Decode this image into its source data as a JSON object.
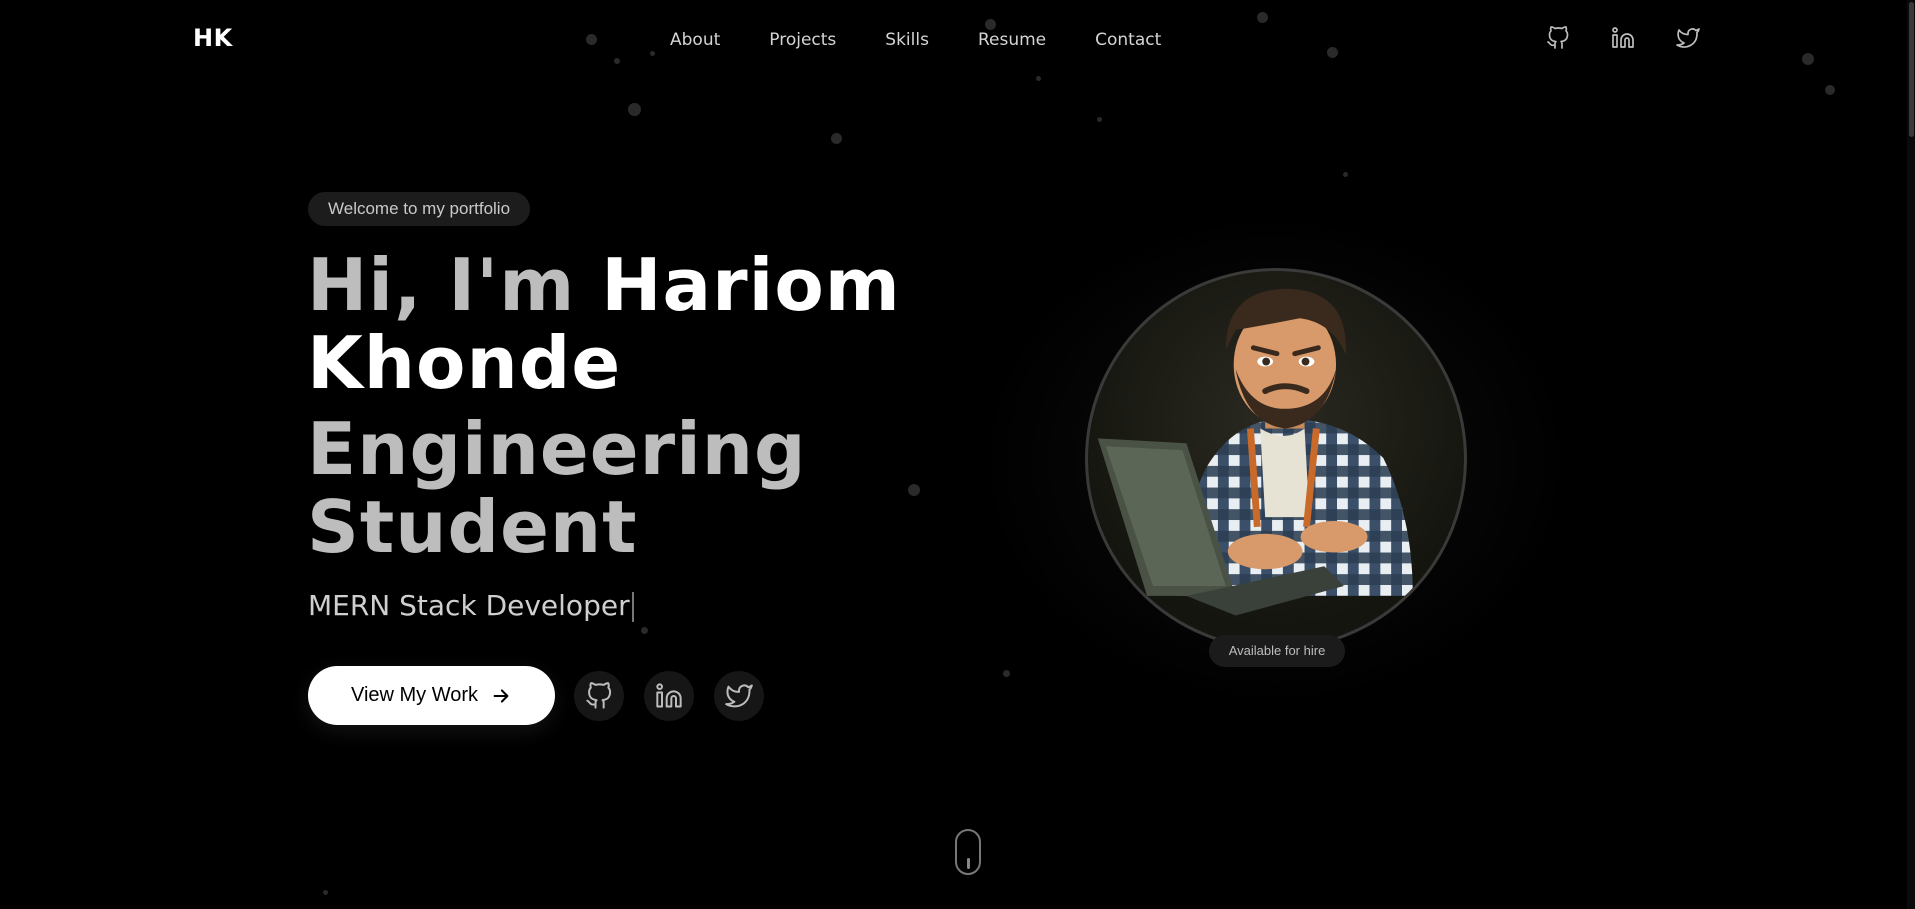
{
  "brand": {
    "logo": "HK"
  },
  "nav": {
    "items": [
      {
        "label": "About"
      },
      {
        "label": "Projects"
      },
      {
        "label": "Skills"
      },
      {
        "label": "Resume"
      },
      {
        "label": "Contact"
      }
    ]
  },
  "header_social": [
    "github-icon",
    "linkedin-icon",
    "twitter-icon"
  ],
  "hero": {
    "welcome": "Welcome to my portfolio",
    "greeting": "Hi, I'm ",
    "name_line1": "Hariom",
    "name_line2": "Khonde",
    "role_line1": "Engineering",
    "role_line2": "Student",
    "typing_text": "MERN Stack Developer",
    "cta_label": "View My Work",
    "social": [
      "github-icon",
      "linkedin-icon",
      "twitter-icon"
    ]
  },
  "avatar": {
    "badge": "Available for hire"
  },
  "colors": {
    "background": "#000000",
    "accent": "#ffffff",
    "muted": "#bdbdbd"
  }
}
